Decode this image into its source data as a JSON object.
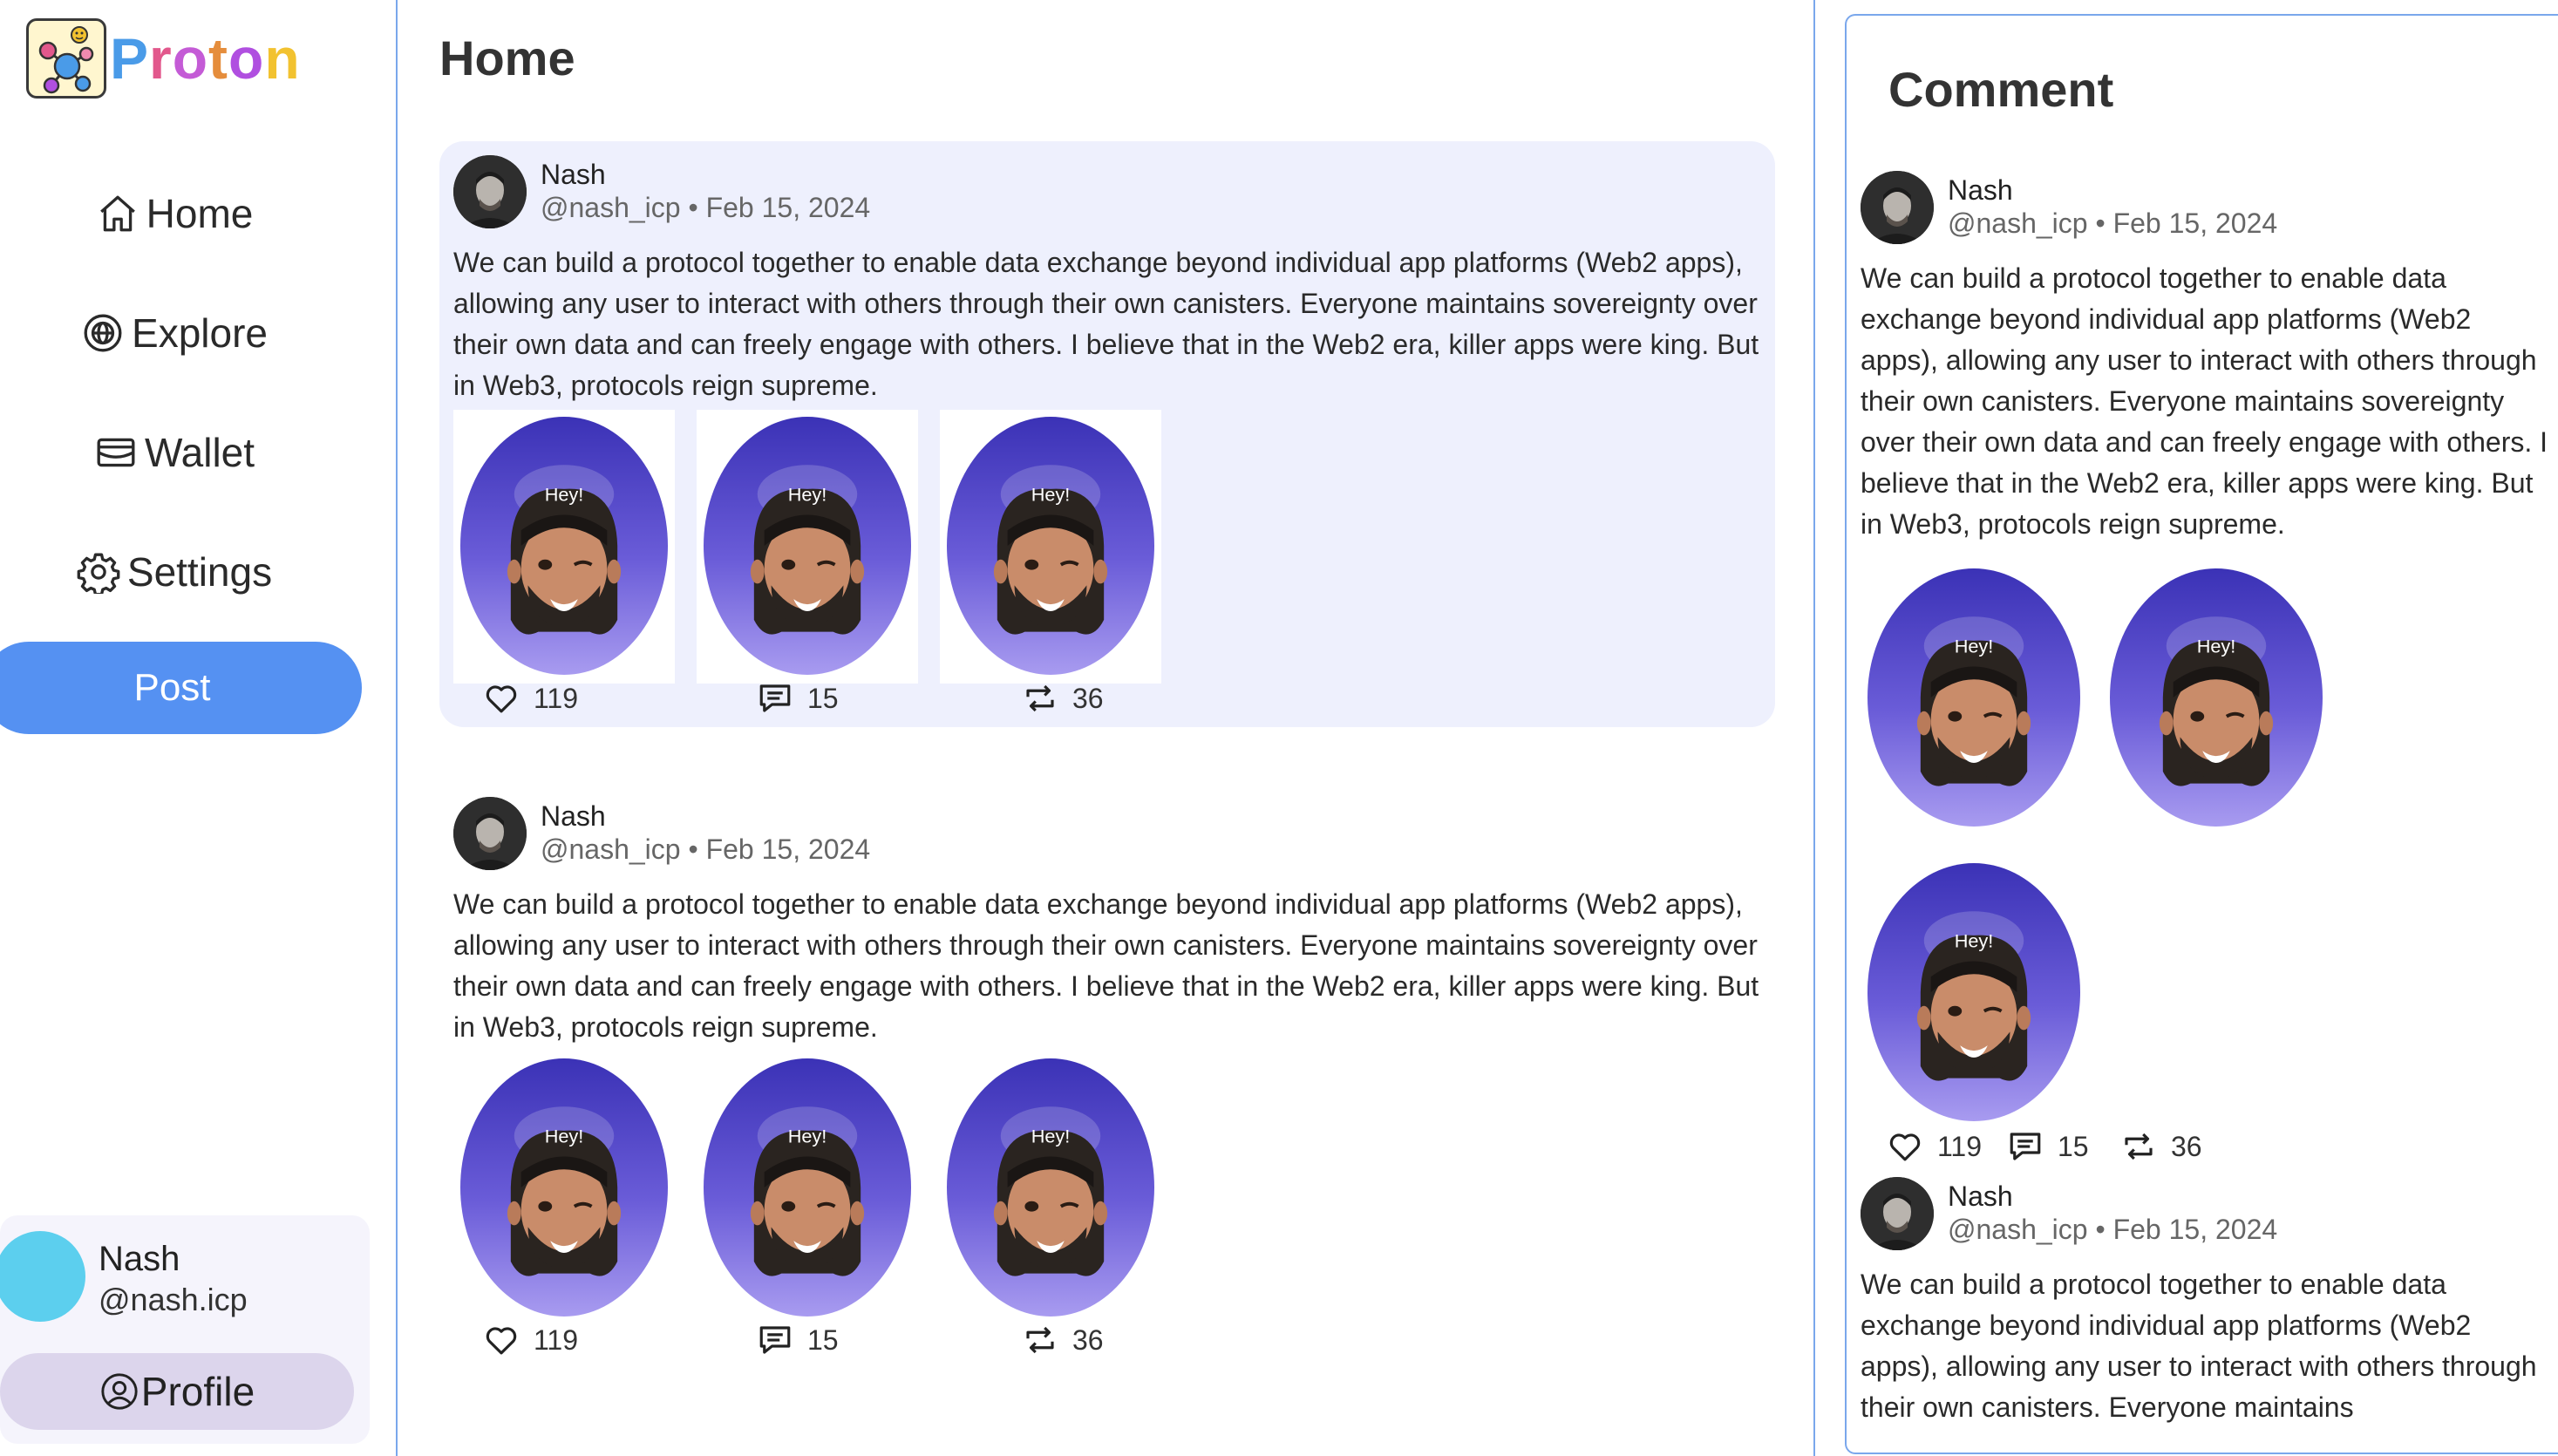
{
  "app": {
    "name_letters": [
      "P",
      "r",
      "o",
      "t",
      "o",
      "n"
    ],
    "name_colors": [
      "#4a9be8",
      "#e2588c",
      "#c45bd6",
      "#e58d3c",
      "#b04fe0",
      "#f2c230"
    ]
  },
  "nav": {
    "items": [
      {
        "label": "Home",
        "icon": "home-icon"
      },
      {
        "label": "Explore",
        "icon": "globe-icon"
      },
      {
        "label": "Wallet",
        "icon": "wallet-icon"
      },
      {
        "label": "Settings",
        "icon": "gear-icon"
      }
    ],
    "post_label": "Post"
  },
  "user": {
    "name": "Nash",
    "handle": "@nash.icp",
    "profile_label": "Profile"
  },
  "main": {
    "title": "Home",
    "posts": [
      {
        "author": "Nash",
        "handle": "@nash_icp",
        "date": "Feb 15, 2024",
        "meta": "@nash_icp • Feb 15, 2024",
        "text": "We can build a protocol together to enable data exchange beyond individual app platforms (Web2 apps), allowing any user to interact with others through their own canisters. Everyone maintains sovereignty over their own data and can freely engage with others. I believe that in the Web2 era, killer apps were king. But in Web3, protocols reign supreme.",
        "image_caption": "Hey!",
        "likes": "119",
        "comments": "15",
        "reposts": "36"
      },
      {
        "author": "Nash",
        "handle": "@nash_icp",
        "date": "Feb 15, 2024",
        "meta": "@nash_icp • Feb 15, 2024",
        "text": "We can build a protocol together to enable data exchange beyond individual app platforms (Web2 apps), allowing any user to interact with others through their own canisters. Everyone maintains sovereignty over their own data and can freely engage with others. I believe that in the Web2 era, killer apps were king. But in Web3, protocols reign supreme.",
        "image_caption": "Hey!",
        "likes": "119",
        "comments": "15",
        "reposts": "36"
      }
    ]
  },
  "comment": {
    "title": "Comment",
    "posts": [
      {
        "author": "Nash",
        "meta": "@nash_icp • Feb 15, 2024",
        "text": "We can build a protocol together to enable data exchange beyond individual app platforms (Web2 apps), allowing any user to interact with others through their own canisters. Everyone maintains sovereignty over their own data and can freely engage with others. I believe that in the Web2 era, killer apps were king. But in Web3, protocols reign supreme.",
        "image_caption": "Hey!",
        "likes": "119",
        "comments": "15",
        "reposts": "36"
      },
      {
        "author": "Nash",
        "meta": "@nash_icp • Feb 15, 2024",
        "text": "We can build a protocol together to enable data exchange beyond individual app platforms (Web2 apps), allowing any user to interact with others through their own canisters. Everyone maintains"
      }
    ]
  },
  "colors": {
    "accent": "#5591f2",
    "border": "#7aa7ec",
    "highlight_bg": "#eef0fd",
    "profile_btn": "#dcd5ec",
    "user_avatar": "#5ccfee"
  }
}
